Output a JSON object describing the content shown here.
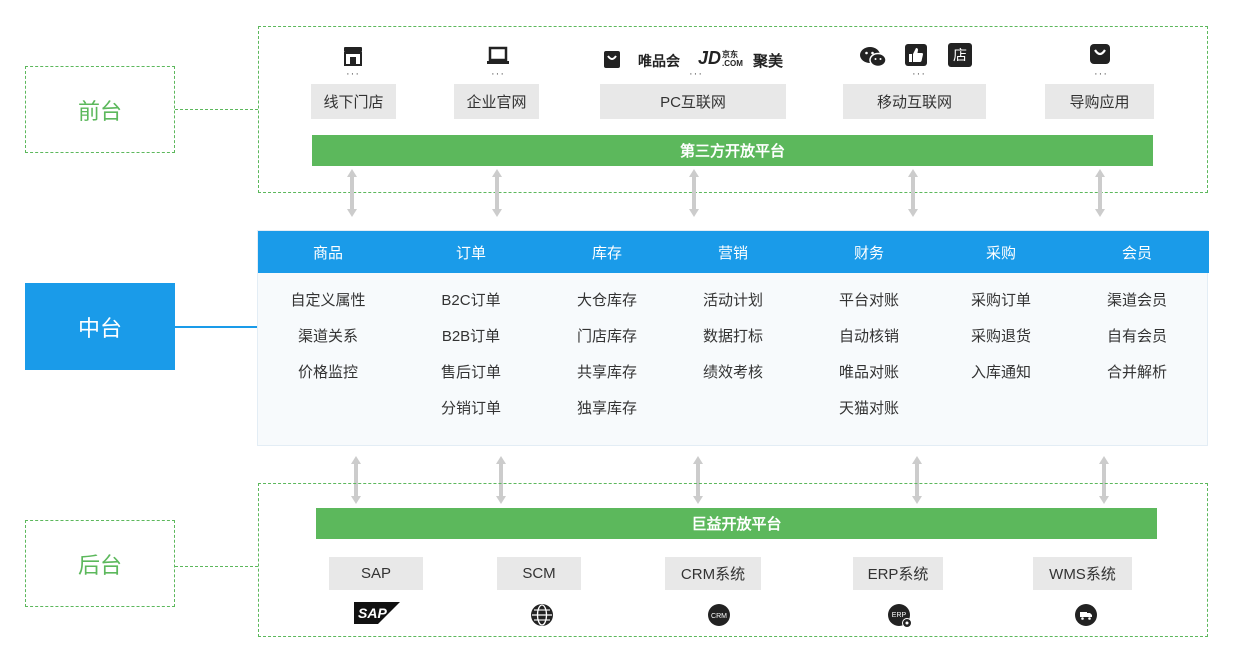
{
  "tiers": {
    "front": "前台",
    "middle": "中台",
    "back": "后台"
  },
  "front": {
    "channels": [
      {
        "label": "线下门店",
        "icon": "store-icon"
      },
      {
        "label": "企业官网",
        "icon": "laptop-icon"
      },
      {
        "label": "PC互联网",
        "icon": "shop-bag-icon"
      },
      {
        "label": "移动互联网",
        "icon": "wechat-icon"
      },
      {
        "label": "导购应用",
        "icon": "guide-app-icon"
      }
    ],
    "brands": {
      "vip": "唯品会",
      "jd": "JD",
      "jd_sub_top": "京东",
      "jd_sub_bottom": ".COM",
      "jumei": "聚美",
      "dian": "店"
    },
    "dots": "···",
    "bar": "第三方开放平台"
  },
  "middle": {
    "columns": [
      {
        "header": "商品",
        "items": [
          "自定义属性",
          "渠道关系",
          "价格监控"
        ]
      },
      {
        "header": "订单",
        "items": [
          "B2C订单",
          "B2B订单",
          "售后订单",
          "分销订单"
        ]
      },
      {
        "header": "库存",
        "items": [
          "大仓库存",
          "门店库存",
          "共享库存",
          "独享库存"
        ]
      },
      {
        "header": "营销",
        "items": [
          "活动计划",
          "数据打标",
          "绩效考核"
        ]
      },
      {
        "header": "财务",
        "items": [
          "平台对账",
          "自动核销",
          "唯品对账",
          "天猫对账"
        ]
      },
      {
        "header": "采购",
        "items": [
          "采购订单",
          "采购退货",
          "入库通知"
        ]
      },
      {
        "header": "会员",
        "items": [
          "渠道会员",
          "自有会员",
          "合并解析"
        ]
      }
    ]
  },
  "back": {
    "bar": "巨益开放平台",
    "systems": [
      {
        "label": "SAP",
        "icon": "sap-logo-icon",
        "badge": "SAP"
      },
      {
        "label": "SCM",
        "icon": "globe-icon",
        "badge": ""
      },
      {
        "label": "CRM系统",
        "icon": "crm-icon",
        "badge": "CRM"
      },
      {
        "label": "ERP系统",
        "icon": "erp-icon",
        "badge": "ERP"
      },
      {
        "label": "WMS系统",
        "icon": "truck-icon",
        "badge": ""
      }
    ]
  },
  "colors": {
    "green": "#5cb85c",
    "blue": "#1a9be9",
    "gray_box": "#e8e8e8",
    "arrow": "#cccccc"
  }
}
